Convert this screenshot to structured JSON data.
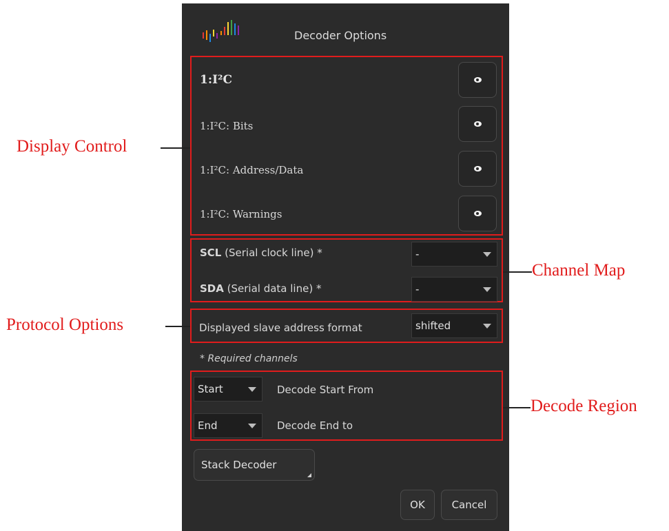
{
  "dialog": {
    "title": "Decoder Options",
    "logo_colors": [
      "#e53935",
      "#fb8c00",
      "#fdd835",
      "#43a047",
      "#1e88e5",
      "#8e24aa"
    ]
  },
  "display_control": {
    "rows": [
      {
        "label": "1:I²C",
        "toggle_icon": "eye-icon"
      },
      {
        "label": "1:I²C: Bits",
        "toggle_icon": "eye-icon"
      },
      {
        "label": "1:I²C: Address/Data",
        "toggle_icon": "eye-icon"
      },
      {
        "label": "1:I²C: Warnings",
        "toggle_icon": "eye-icon"
      }
    ]
  },
  "channel_map": {
    "rows": [
      {
        "key": "SCL",
        "desc": " (Serial clock line) *",
        "value": "-"
      },
      {
        "key": "SDA",
        "desc": " (Serial data line) *",
        "value": "-"
      }
    ]
  },
  "protocol_options": {
    "label": "Displayed slave address format",
    "value": "shifted"
  },
  "required_note": "* Required channels",
  "decode_region": {
    "start": {
      "value": "Start",
      "label": "Decode Start From"
    },
    "end": {
      "value": "End",
      "label": "Decode End to"
    }
  },
  "stack_decoder_label": "Stack Decoder",
  "ok_label": "OK",
  "cancel_label": "Cancel",
  "annotations": {
    "display_control": "Display Control",
    "channel_map": "Channel Map",
    "protocol_options": "Protocol Options",
    "decode_region": "Decode Region",
    "color": "#e11c1c"
  }
}
